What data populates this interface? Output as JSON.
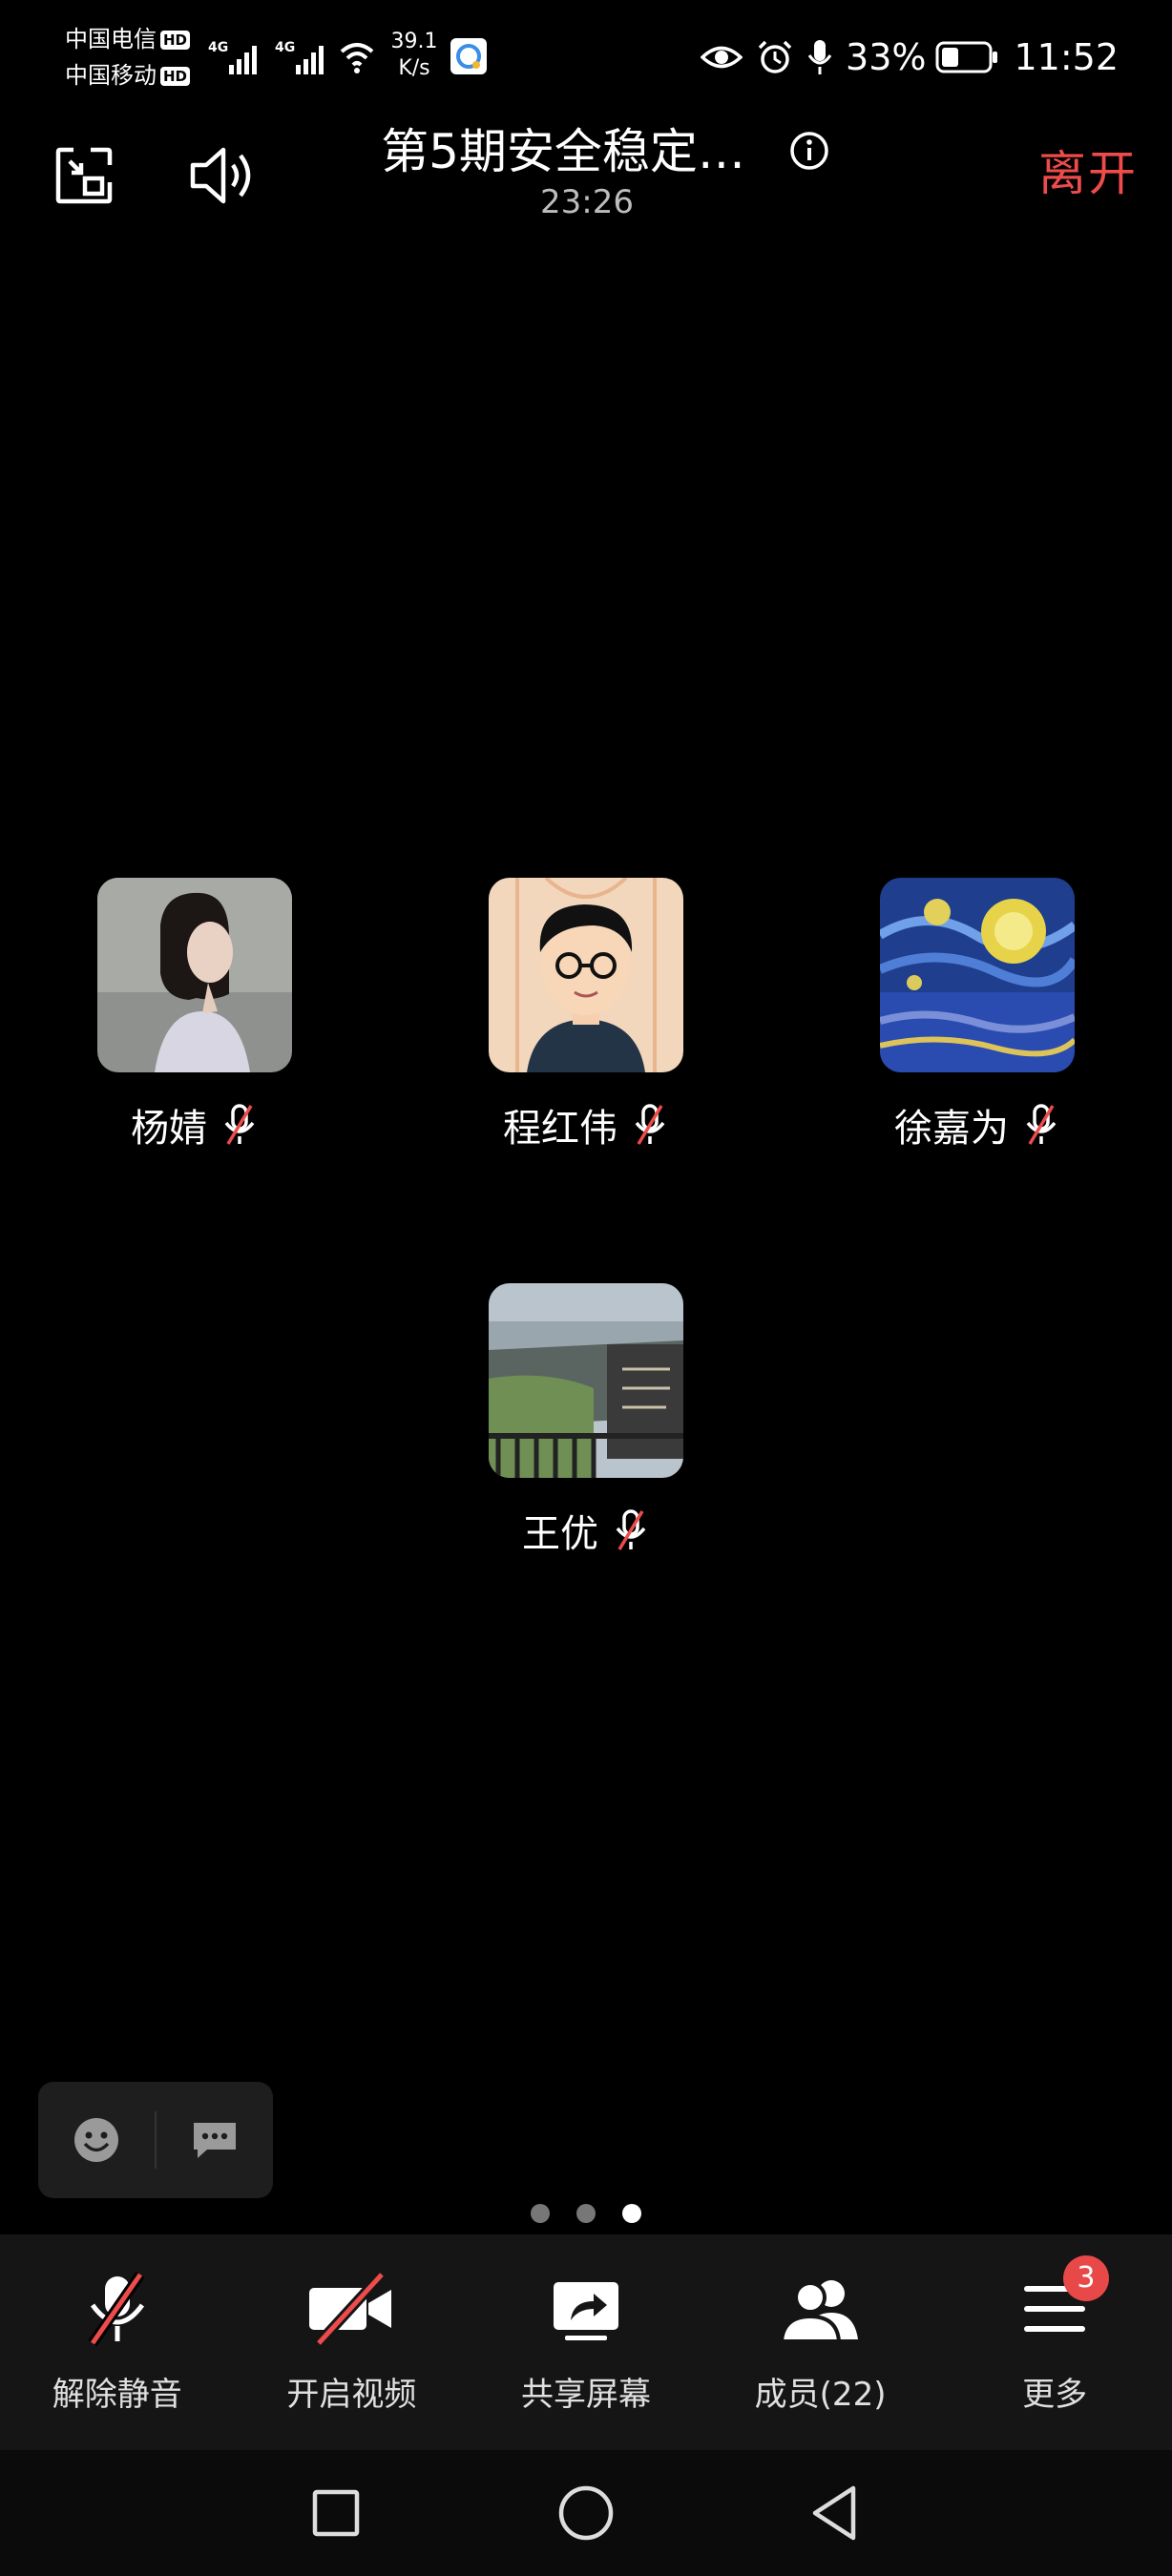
{
  "status_bar": {
    "carrier_1": "中国电信",
    "carrier_2": "中国移动",
    "hd_badge": "HD",
    "net_type": "4G",
    "speed_value": "39.1",
    "speed_unit": "K/s",
    "battery": "33%",
    "time": "11:52",
    "icons": [
      "signal-icon",
      "wifi-icon",
      "eye-icon",
      "alarm-icon",
      "microphone-icon",
      "battery-icon"
    ]
  },
  "top_bar": {
    "title": "第5期安全稳定…",
    "timer": "23:26",
    "leave_label": "离开",
    "icons": [
      "minimize-window-icon",
      "speaker-icon",
      "info-icon"
    ],
    "accent_color": "#ee4b4b"
  },
  "participants": [
    {
      "name": "杨婧",
      "muted": true,
      "avatar": "photo-girl-profile"
    },
    {
      "name": "程红伟",
      "muted": true,
      "avatar": "cartoon-man-glasses"
    },
    {
      "name": "徐嘉为",
      "muted": true,
      "avatar": "starry-night-painting"
    },
    {
      "name": "王优",
      "muted": true,
      "avatar": "rooftop-photo"
    }
  ],
  "reaction": {
    "icons": [
      "emoji-icon",
      "chat-icon"
    ]
  },
  "pager": {
    "count": 3,
    "active": 3
  },
  "toolbar": [
    {
      "label": "解除静音",
      "icon": "microphone-muted-icon"
    },
    {
      "label": "开启视频",
      "icon": "video-off-icon"
    },
    {
      "label": "共享屏幕",
      "icon": "share-screen-icon"
    },
    {
      "label": "成员(22)",
      "icon": "members-icon"
    },
    {
      "label": "更多",
      "icon": "menu-icon",
      "badge": "3"
    }
  ],
  "nav": {
    "icons": [
      "recents-square-icon",
      "home-circle-icon",
      "back-triangle-icon"
    ]
  }
}
